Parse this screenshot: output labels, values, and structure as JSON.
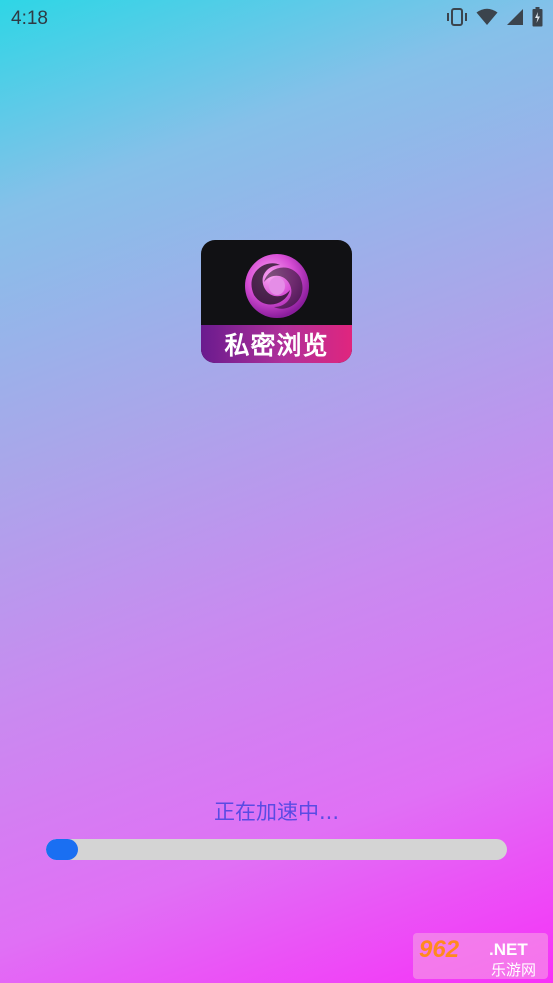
{
  "status_bar": {
    "time": "4:18",
    "icons": [
      "vibrate-icon",
      "wifi-icon",
      "signal-icon",
      "battery-charging-icon"
    ]
  },
  "app": {
    "logo_text": "私密浏览",
    "logo_emblem": "swirl-orb-icon"
  },
  "loading": {
    "text": "正在加速中...",
    "progress": 0.07
  },
  "watermark": {
    "text_top": "962.NET",
    "text_bottom": "乐游网"
  },
  "colors": {
    "background_top": "#2ed6e6",
    "background_bottom": "#f730f8",
    "loading_text": "#5a4be3",
    "progress_fill": "#1a6ff2",
    "progress_track": "#d4d4d4"
  }
}
